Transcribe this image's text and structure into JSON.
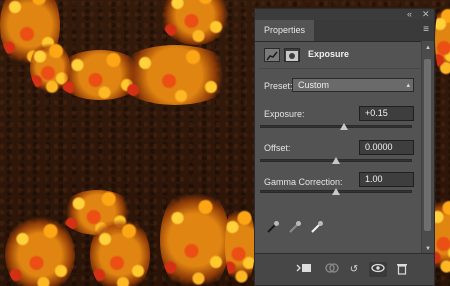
{
  "panel": {
    "title_tab": "Properties",
    "collapse_icon": "double-chevron-icon",
    "close_icon": "close-icon",
    "adjustment_title": "Exposure",
    "preset": {
      "label": "Preset:",
      "value": "Custom"
    },
    "exposure": {
      "label": "Exposure:",
      "value": "+0.15",
      "slider_fraction": 0.55
    },
    "offset": {
      "label": "Offset:",
      "value": "0.0000",
      "slider_fraction": 0.5
    },
    "gamma": {
      "label": "Gamma Correction:",
      "value": "1.00",
      "slider_fraction": 0.5
    },
    "eyedroppers": [
      "black-point-eyedropper-icon",
      "gray-point-eyedropper-icon",
      "white-point-eyedropper-icon"
    ],
    "footer_buttons": [
      "clip-to-layer-icon",
      "view-previous-icon",
      "reset-icon",
      "visibility-eye-icon",
      "trash-icon"
    ]
  },
  "colors": {
    "panel_bg": "#535353",
    "leaf_orange": "#f5a623",
    "leaf_red": "#e0521c",
    "leaf_yellow": "#ffd24a"
  }
}
